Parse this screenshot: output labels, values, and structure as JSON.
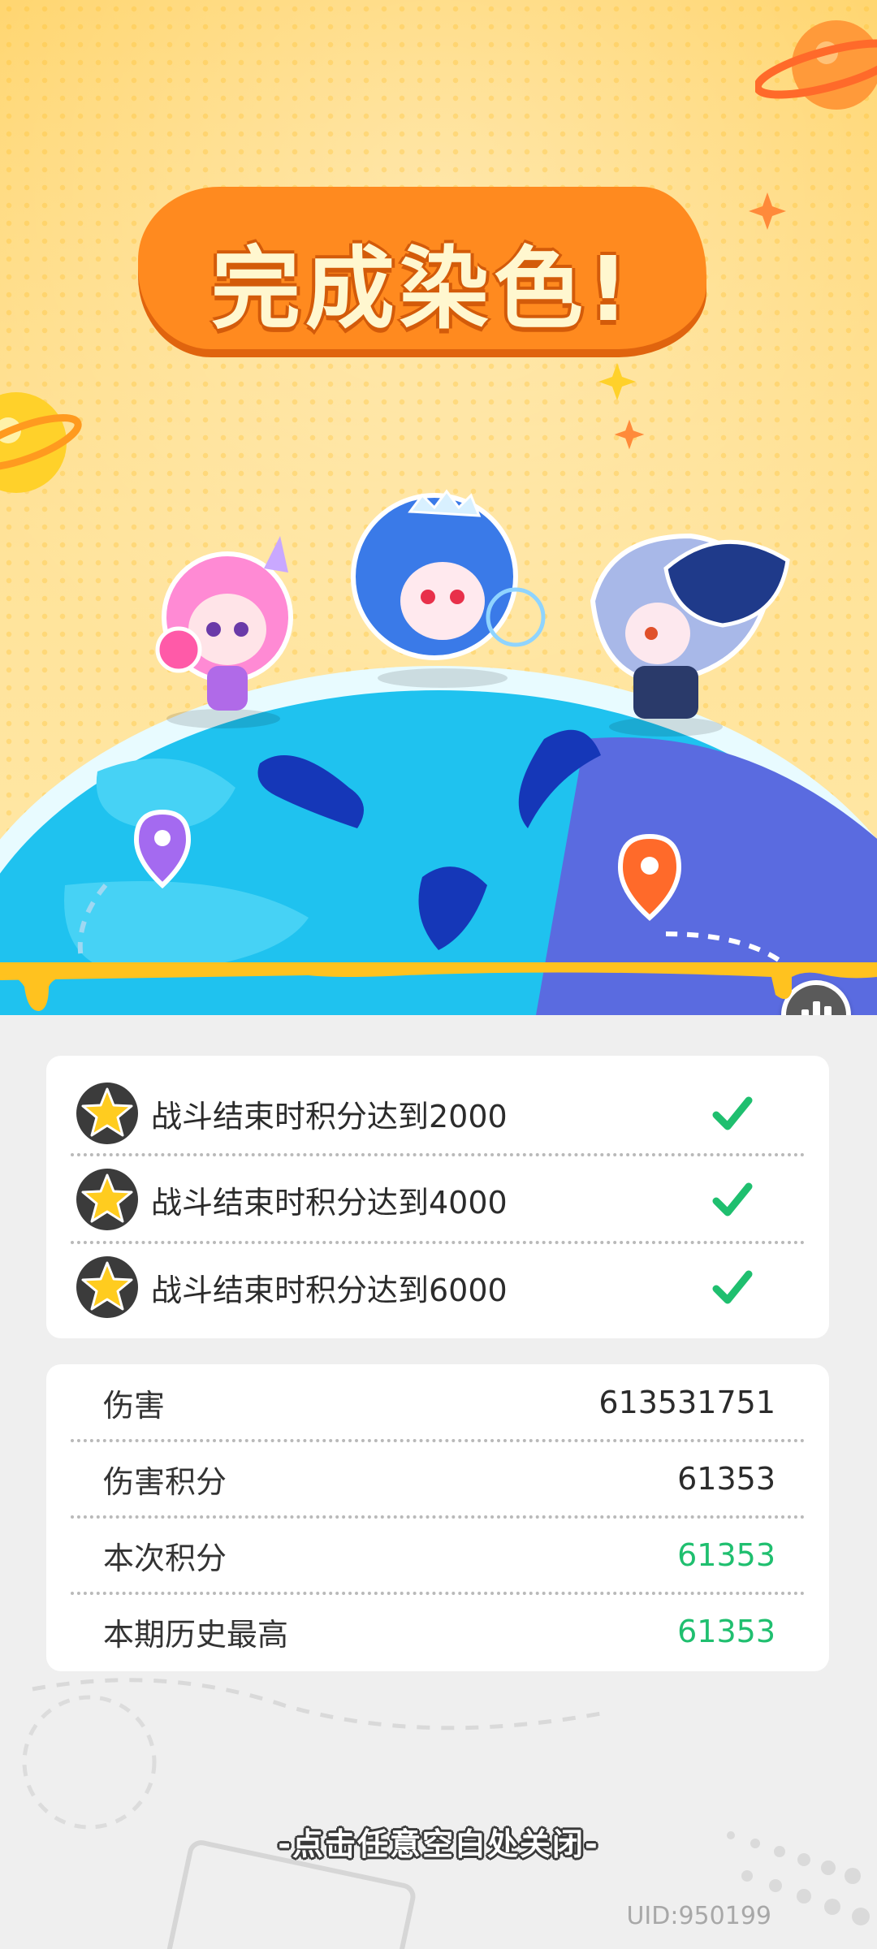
{
  "header": {
    "title": "完成染色!"
  },
  "tasks": {
    "items": [
      {
        "label": "战斗结束时积分达到2000",
        "completed": true
      },
      {
        "label": "战斗结束时积分达到4000",
        "completed": true
      },
      {
        "label": "战斗结束时积分达到6000",
        "completed": true
      }
    ]
  },
  "stats": {
    "rows": [
      {
        "label": "伤害",
        "value": "613531751",
        "highlight": false
      },
      {
        "label": "伤害积分",
        "value": "61353",
        "highlight": false
      },
      {
        "label": "本次积分",
        "value": "61353",
        "highlight": true
      },
      {
        "label": "本期历史最高",
        "value": "61353",
        "highlight": true
      }
    ]
  },
  "footer": {
    "close_hint": "-点击任意空白处关闭-",
    "uid": "UID:950199"
  },
  "icons": {
    "task_icon": "star-icon",
    "status_icon": "check-icon",
    "rank_button": "leaderboard-icon"
  },
  "colors": {
    "accent_orange": "#ff8a1f",
    "success_green": "#1fbf6f",
    "banner_yellow": "#ffd46a"
  }
}
